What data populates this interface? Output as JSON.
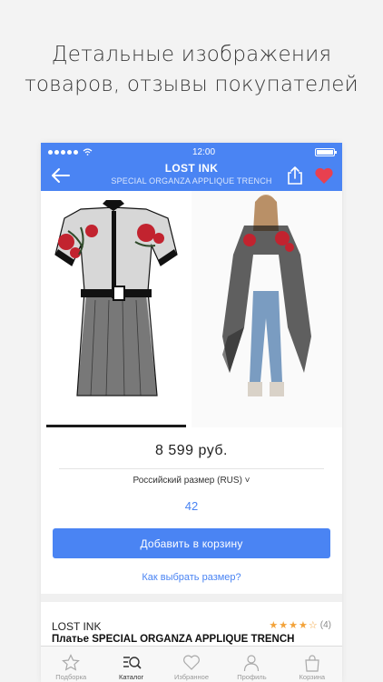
{
  "promo": {
    "line1": "Детальные изображения",
    "line2": "товаров, отзывы покупателей"
  },
  "status": {
    "time": "12:00"
  },
  "header": {
    "title": "LOST INK",
    "subtitle": "SPECIAL ORGANZA APPLIQUE TRENCH"
  },
  "product": {
    "price": "8 599 руб.",
    "size_label": "Российский размер (RUS) ˅",
    "size_value": "42",
    "add_to_cart": "Добавить в корзину",
    "size_help": "Как выбрать размер?",
    "brand": "LOST INK",
    "name": "Платье SPECIAL ORGANZA APPLIQUE TRENCH",
    "rating": 4,
    "rating_count": "(4)"
  },
  "tabbar": {
    "items": [
      {
        "label": "Подборка",
        "icon": "star-icon",
        "active": false
      },
      {
        "label": "Каталог",
        "icon": "catalog-search-icon",
        "active": true
      },
      {
        "label": "Избранное",
        "icon": "heart-icon",
        "active": false
      },
      {
        "label": "Профиль",
        "icon": "profile-icon",
        "active": false
      },
      {
        "label": "Корзина",
        "icon": "bag-icon",
        "active": false
      }
    ]
  },
  "colors": {
    "accent": "#4a84f3",
    "heart": "#e8404f",
    "star": "#f3a33a",
    "rose": "#c2232f"
  }
}
